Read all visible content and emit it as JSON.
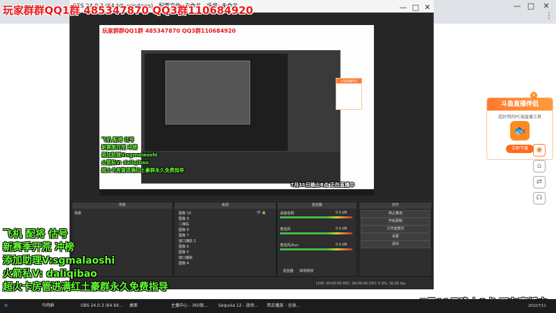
{
  "overlay": {
    "group_text": "玩家群群QQ1群 485347870 QQ3群110684920",
    "inner_group_text": "玩家群群QQ1群 485347870 QQ3群110684920",
    "promo_lines": [
      "飞机 配将 估号",
      "新赛季开荒 冲榜",
      "添加助理V:sgmalaoshi",
      "火箭私V: daliqibao",
      "超火卡房管进满红土豪群永久免费指导"
    ],
    "inner_promo_lines": [
      "飞机 配将 估号",
      "新赛季开荒 冲榜",
      "添加助理V:sgmalaoshi",
      "火箭私V: daliqibao",
      "超火卡房管进满红土豪群永久免费指导"
    ],
    "schedule": "7月11日晚上8点  正在直播中",
    "inner_schedule": "7月11日晚上8点  正在直播中",
    "date_small": "2022/7/11"
  },
  "browser": {
    "close": "✕",
    "minimize": "—",
    "maximize": "□",
    "menu": "⋮"
  },
  "ad": {
    "title": "斗鱼直播伴侣",
    "subtitle": "超好用的PC端直播工具",
    "logo": "🐟",
    "button": "立即下载",
    "inner_title": "斗鱼直播伴侣"
  },
  "obs": {
    "title": "OBS 24.0.3 (64 bit, windows) - 配置文件: 未命名 - 场景: 未命名",
    "docks": {
      "scenes": "场景",
      "sources": "来源",
      "mixer": "混音器",
      "controls": "控件"
    },
    "scene_item": "场景",
    "sources": [
      "图像 10",
      "图像 9",
      "二维码",
      "图像 8",
      "图像 7",
      "窗口捕获 2",
      "图像 6",
      "图像 5",
      "窗口捕获",
      "图像 4"
    ],
    "mixer": [
      {
        "name": "桌面音频",
        "db": "0.0 dB"
      },
      {
        "name": "麦克风",
        "db": "0.0 dB"
      },
      {
        "name": "麦克风/Aux",
        "db": "0.0 dB"
      }
    ],
    "mixer_tabs": [
      "混音器",
      "转场特效"
    ],
    "controls": [
      "停止推流",
      "开始录制",
      "工作室模式",
      "设置",
      "退出"
    ],
    "status": "LIVE: 00:00:00    REC: 00:00:00    CPU: 5.0%, 30.00 fps"
  },
  "taskbar": {
    "items": [
      "乌鸡群",
      "OBS 24.0.3 (64 bit...",
      "桌面",
      "主播中心 - 360极...",
      "Sequoia 12 - 战场...",
      "西瓜播放 - 全球..."
    ],
    "time": "2022/7/11"
  },
  "colors": {
    "red": "#e61b1b",
    "green": "#66ff33",
    "orange": "#ff7a30"
  }
}
